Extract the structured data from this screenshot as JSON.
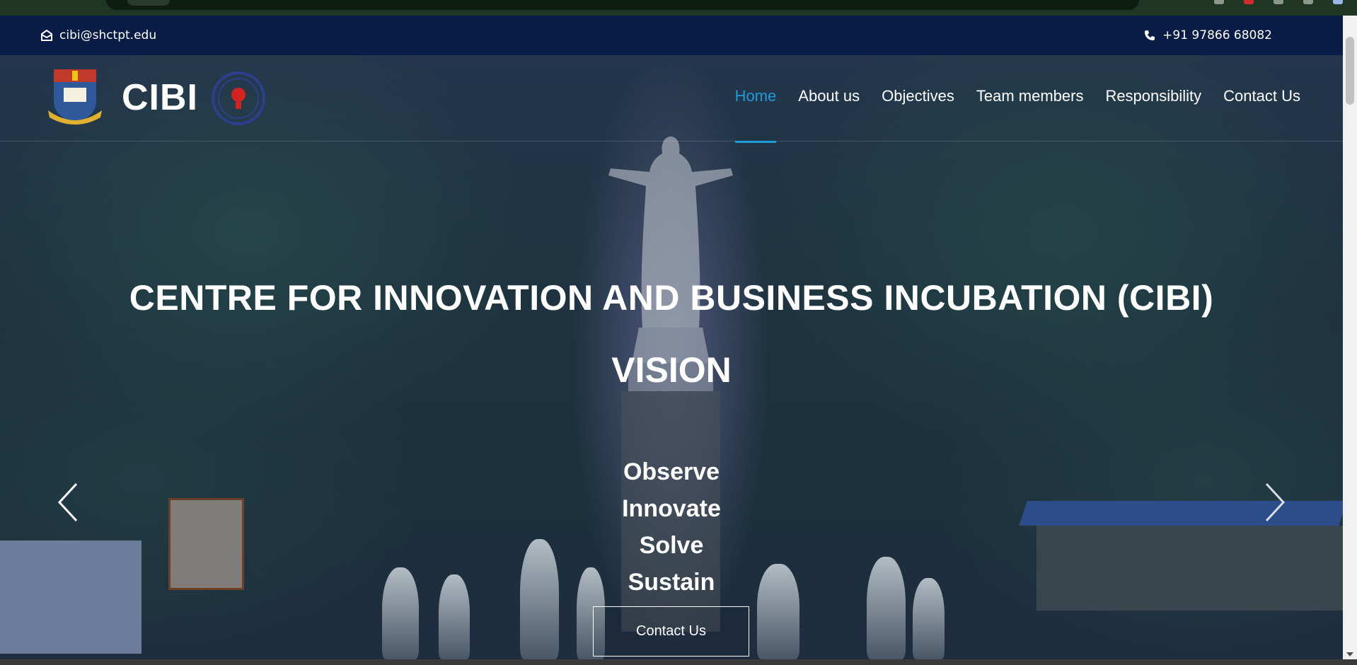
{
  "topbar": {
    "email": "cibi@shctpt.edu",
    "email_icon": "envelope-icon",
    "phone": "+91 97866 68082",
    "phone_icon": "phone-icon"
  },
  "nav": {
    "brand": "CIBI",
    "items": [
      {
        "label": "Home",
        "active": true
      },
      {
        "label": "About us"
      },
      {
        "label": "Objectives"
      },
      {
        "label": "Team members"
      },
      {
        "label": "Responsibility"
      },
      {
        "label": "Contact Us"
      }
    ]
  },
  "hero": {
    "title": "CENTRE FOR INNOVATION AND BUSINESS INCUBATION (CIBI)",
    "subtitle": "VISION",
    "words": [
      "Observe",
      "Innovate",
      "Solve",
      "Sustain"
    ],
    "cta": "Contact Us",
    "prev_icon": "chevron-left-icon",
    "next_icon": "chevron-right-icon"
  },
  "colors": {
    "topbar_bg": "#081c45",
    "accent": "#1e9bd7",
    "overlay": "#101e46"
  }
}
